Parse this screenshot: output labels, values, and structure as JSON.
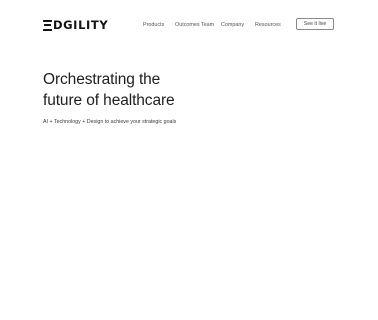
{
  "brand": {
    "name": "EDGILITY",
    "logo_text": "DGILITY"
  },
  "nav": {
    "items": [
      "Products",
      "Outcomes Team",
      "Company",
      "Resources"
    ],
    "cta_label": "See it live"
  },
  "hero": {
    "title_line1": "Orchestrating the",
    "title_line2": "future of healthcare",
    "subtitle": "AI + Technology + Design to achieve your strategic goals"
  }
}
